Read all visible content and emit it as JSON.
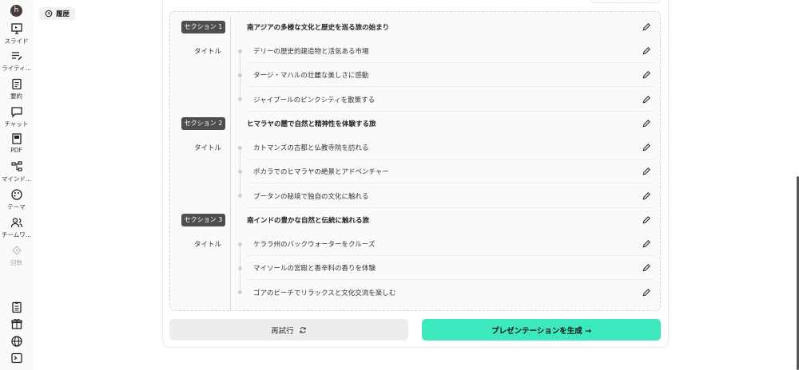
{
  "user": {
    "initial": "h"
  },
  "rail": {
    "items": [
      {
        "label": "スライド",
        "icon": "presentation-icon"
      },
      {
        "label": "ライティ...",
        "icon": "writing-icon"
      },
      {
        "label": "要約",
        "icon": "clipboard-icon"
      },
      {
        "label": "チャット",
        "icon": "chat-icon"
      },
      {
        "label": "PDF",
        "icon": "pdf-icon"
      },
      {
        "label": "マインド...",
        "icon": "mindmap-icon"
      },
      {
        "label": "テーマ",
        "icon": "palette-icon"
      },
      {
        "label": "チームワ...",
        "icon": "team-icon"
      },
      {
        "label": "回数",
        "icon": "credits-icon"
      }
    ],
    "bottom": [
      "clipboard-list-icon",
      "gift-icon",
      "globe-icon",
      "terminal-icon"
    ]
  },
  "history": {
    "label": "履歴"
  },
  "outline": {
    "title_label": "タイトル",
    "sections": [
      {
        "badge": "セクション 1",
        "heading": "南アジアの多様な文化と歴史を巡る旅の始まり",
        "items": [
          "デリーの歴史的建造物と活気ある市場",
          "タージ・マハルの壮麗な美しさに感動",
          "ジャイプールのピンクシティを散策する"
        ]
      },
      {
        "badge": "セクション 2",
        "heading": "ヒマラヤの麓で自然と精神性を体験する旅",
        "items": [
          "カトマンズの古都と仏教寺院を訪れる",
          "ポカラでのヒマラヤの絶景とアドベンチャー",
          "ブータンの秘境で独自の文化に触れる"
        ]
      },
      {
        "badge": "セクション 3",
        "heading": "南インドの豊かな自然と伝統に触れる旅",
        "items": [
          "ケララ州のバックウォーターをクルーズ",
          "マイソールの宮殿と香辛料の香りを体験",
          "ゴアのビーチでリラックスと文化交流を楽しむ"
        ]
      }
    ]
  },
  "actions": {
    "retry": "再試行",
    "generate": "プレゼンテーションを生成 →"
  },
  "colors": {
    "accent": "#3ee8bf",
    "badge": "#4e4e4e"
  }
}
